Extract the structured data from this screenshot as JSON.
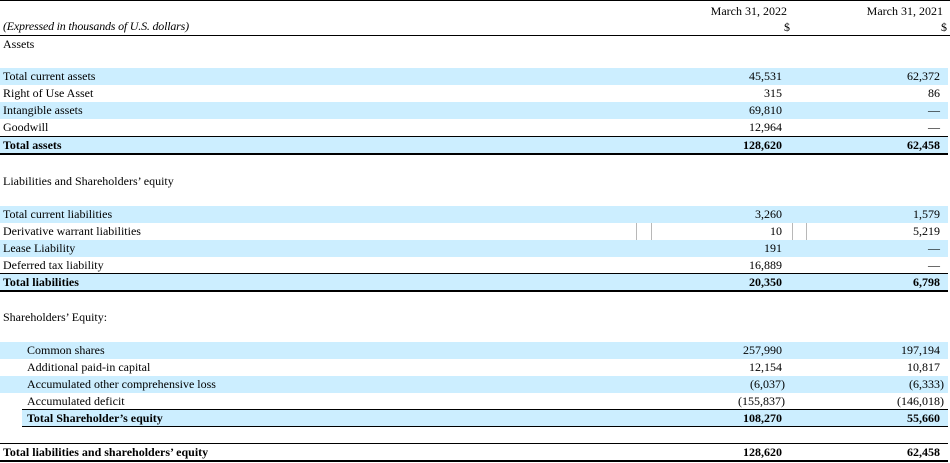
{
  "header": {
    "note": "(Expressed in thousands of U.S. dollars)",
    "col1_date": "March 31, 2022",
    "col1_currency": "$",
    "col2_date": "March 31, 2021",
    "col2_currency": "$"
  },
  "sections": {
    "assets": "Assets",
    "liabilities": "Liabilities and Shareholders’ equity",
    "equity": "Shareholders’ Equity:"
  },
  "assets": [
    {
      "label": "Total current assets",
      "v2022": "45,531",
      "v2021": "62,372"
    },
    {
      "label": "Right of Use Asset",
      "v2022": "315",
      "v2021": "86"
    },
    {
      "label": "Intangible assets",
      "v2022": "69,810",
      "v2021": "—"
    },
    {
      "label": "Goodwill",
      "v2022": "12,964",
      "v2021": "—"
    },
    {
      "label": "Total assets",
      "v2022": "128,620",
      "v2021": "62,458"
    }
  ],
  "liabilities": [
    {
      "label": "Total current liabilities",
      "v2022": "3,260",
      "v2021": "1,579"
    },
    {
      "label": "Derivative warrant liabilities",
      "v2022": "10",
      "v2021": "5,219"
    },
    {
      "label": "Lease Liability",
      "v2022": "191",
      "v2021": "—"
    },
    {
      "label": "Deferred tax liability",
      "v2022": "16,889",
      "v2021": "—"
    },
    {
      "label": "Total liabilities",
      "v2022": "20,350",
      "v2021": "6,798"
    }
  ],
  "equity": [
    {
      "label": "Common shares",
      "v2022": "257,990",
      "v2021": "197,194"
    },
    {
      "label": "Additional paid-in capital",
      "v2022": "12,154",
      "v2021": "10,817"
    },
    {
      "label": "Accumulated other comprehensive loss",
      "v2022": "(6,037)",
      "v2021": "(6,333)"
    },
    {
      "label": "Accumulated deficit",
      "v2022": "(155,837)",
      "v2021": "(146,018)"
    },
    {
      "label": "Total Shareholder’s equity",
      "v2022": "108,270",
      "v2021": "55,660"
    }
  ],
  "grand_total": {
    "label": "Total liabilities and shareholders’ equity",
    "v2022": "128,620",
    "v2021": "62,458"
  }
}
